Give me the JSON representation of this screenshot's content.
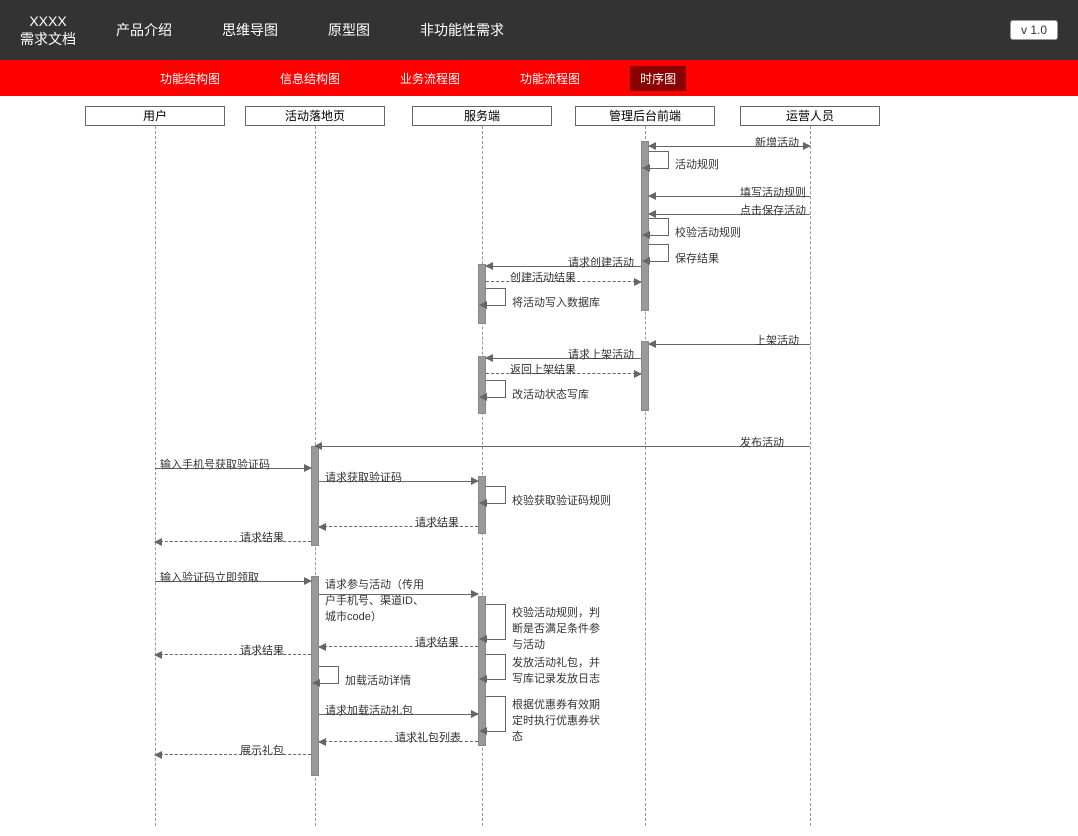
{
  "header": {
    "logo_line1": "XXXX",
    "logo_line2": "需求文档",
    "version": "v 1.0",
    "nav": [
      "产品介绍",
      "思维导图",
      "原型图",
      "非功能性需求"
    ]
  },
  "subnav": {
    "items": [
      "功能结构图",
      "信息结构图",
      "业务流程图",
      "功能流程图",
      "时序图"
    ],
    "active_index": 4
  },
  "chart_data": {
    "type": "sequence_diagram",
    "participants": [
      "用户",
      "活动落地页",
      "服务端",
      "管理后台前端",
      "运营人员"
    ],
    "messages": [
      {
        "from": "运营人员",
        "to": "管理后台前端",
        "label": "新增活动",
        "kind": "sync"
      },
      {
        "from": "管理后台前端",
        "to": "管理后台前端",
        "label": "活动规则",
        "kind": "self"
      },
      {
        "from": "运营人员",
        "to": "管理后台前端",
        "label": "填写活动规则",
        "kind": "sync"
      },
      {
        "from": "运营人员",
        "to": "管理后台前端",
        "label": "点击保存活动",
        "kind": "sync"
      },
      {
        "from": "管理后台前端",
        "to": "管理后台前端",
        "label": "校验活动规则",
        "kind": "self"
      },
      {
        "from": "管理后台前端",
        "to": "管理后台前端",
        "label": "保存结果",
        "kind": "self"
      },
      {
        "from": "管理后台前端",
        "to": "服务端",
        "label": "请求创建活动",
        "kind": "sync"
      },
      {
        "from": "服务端",
        "to": "管理后台前端",
        "label": "创建活动结果",
        "kind": "return"
      },
      {
        "from": "服务端",
        "to": "服务端",
        "label": "将活动写入数据库",
        "kind": "self"
      },
      {
        "from": "运营人员",
        "to": "管理后台前端",
        "label": "上架活动",
        "kind": "sync"
      },
      {
        "from": "管理后台前端",
        "to": "服务端",
        "label": "请求上架活动",
        "kind": "sync"
      },
      {
        "from": "服务端",
        "to": "管理后台前端",
        "label": "返回上架结果",
        "kind": "return"
      },
      {
        "from": "服务端",
        "to": "服务端",
        "label": "改活动状态写库",
        "kind": "self"
      },
      {
        "from": "运营人员",
        "to": "活动落地页",
        "label": "发布活动",
        "kind": "sync"
      },
      {
        "from": "用户",
        "to": "活动落地页",
        "label": "输入手机号获取验证码",
        "kind": "sync"
      },
      {
        "from": "活动落地页",
        "to": "服务端",
        "label": "请求获取验证码",
        "kind": "sync"
      },
      {
        "from": "服务端",
        "to": "服务端",
        "label": "校验获取验证码规则",
        "kind": "self"
      },
      {
        "from": "服务端",
        "to": "活动落地页",
        "label": "请求结果",
        "kind": "return"
      },
      {
        "from": "活动落地页",
        "to": "用户",
        "label": "请求结果",
        "kind": "return"
      },
      {
        "from": "用户",
        "to": "活动落地页",
        "label": "输入验证码立即领取",
        "kind": "sync"
      },
      {
        "from": "活动落地页",
        "to": "服务端",
        "label": "请求参与活动（传用户手机号、渠道ID、城市code）",
        "kind": "sync"
      },
      {
        "from": "服务端",
        "to": "服务端",
        "label": "校验活动规则，判断是否满足条件参与活动",
        "kind": "self"
      },
      {
        "from": "服务端",
        "to": "活动落地页",
        "label": "请求结果",
        "kind": "return"
      },
      {
        "from": "活动落地页",
        "to": "用户",
        "label": "请求结果",
        "kind": "return"
      },
      {
        "from": "服务端",
        "to": "服务端",
        "label": "发放活动礼包，并写库记录发放日志",
        "kind": "self"
      },
      {
        "from": "活动落地页",
        "to": "活动落地页",
        "label": "加载活动详情",
        "kind": "self"
      },
      {
        "from": "服务端",
        "to": "服务端",
        "label": "根据优惠券有效期定时执行优惠券状态",
        "kind": "self"
      },
      {
        "from": "活动落地页",
        "to": "服务端",
        "label": "请求加载活动礼包",
        "kind": "sync"
      },
      {
        "from": "服务端",
        "to": "活动落地页",
        "label": "请求礼包列表",
        "kind": "return"
      },
      {
        "from": "活动落地页",
        "to": "用户",
        "label": "展示礼包",
        "kind": "return"
      }
    ]
  }
}
